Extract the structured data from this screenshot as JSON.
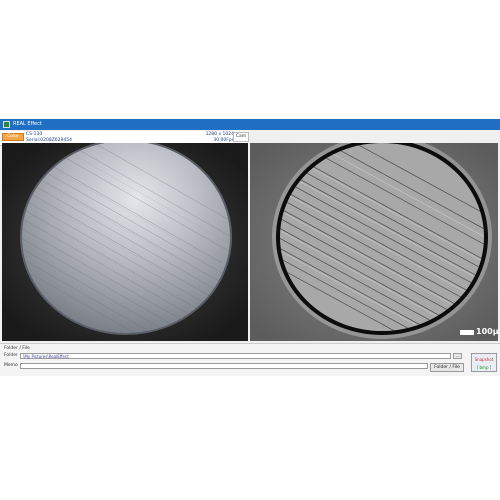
{
  "window": {
    "title": "REAL Effect"
  },
  "camera_info": {
    "color_label": "Color",
    "model": "CS-130",
    "serial": "Serial:0208Z629454",
    "resolution": "1280 x 1024",
    "fps": "30.00Fps",
    "tab_label": "Cam"
  },
  "right_view": {
    "scale_label": "100μm"
  },
  "folder_panel": {
    "title": "Folder / File",
    "folder_label": "Folder",
    "folder_value": "\\My Pictures\\RealEffect",
    "browse_label": "...",
    "memo_label": "Memo",
    "memo_value": "",
    "folder_file_button": "Folder / File",
    "snapshot_label": "Snapshot",
    "format_label": "[ bmp ]"
  },
  "colors": {
    "titlebar": "#1f6fc4",
    "color_button": "#f2a64a",
    "snapshot_text": "#c43030",
    "format_text": "#1a8a2a"
  }
}
